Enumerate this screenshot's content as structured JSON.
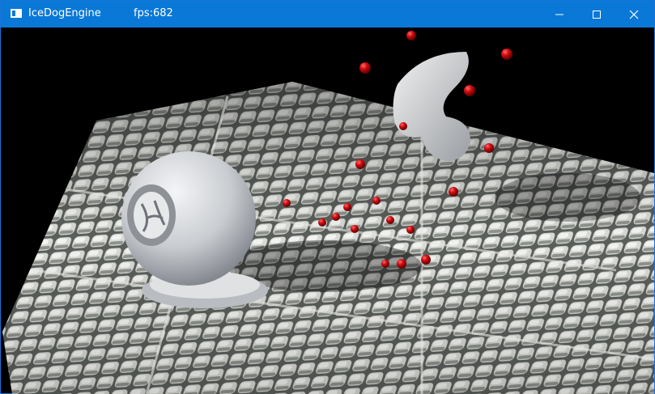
{
  "window": {
    "title": "IceDogEngine",
    "fps_label": "fps:682",
    "titlebar_color": "#0a78d7",
    "controls": [
      {
        "name": "minimize-icon"
      },
      {
        "name": "maximize-icon"
      },
      {
        "name": "close-icon"
      }
    ]
  },
  "scene": {
    "background": "#000000",
    "floor_color": "#c9c9c0",
    "sphere_color": "#d7d9dc",
    "ball_color": "#c8080b",
    "red_balls": 18
  }
}
